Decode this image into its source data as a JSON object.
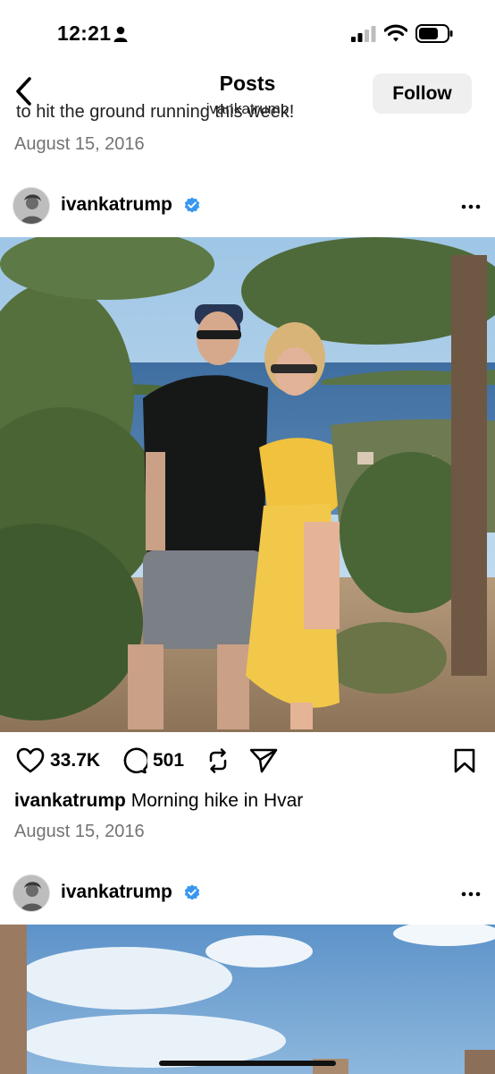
{
  "status_bar": {
    "time": "12:21"
  },
  "header": {
    "title": "Posts",
    "subtitle": "ivankatrump",
    "follow_label": "Follow"
  },
  "previous_post": {
    "caption_fragment": "to hit the ground running this week!",
    "date": "August 15, 2016"
  },
  "post": {
    "username": "ivankatrump",
    "likes": "33.7K",
    "comments": "501",
    "caption_user": "ivankatrump",
    "caption_text": " Morning hike in Hvar",
    "date": "August 15, 2016"
  },
  "next_post": {
    "username": "ivankatrump"
  },
  "icons": {
    "back": "chevron-left-icon",
    "verified": "verified-badge-icon",
    "more": "more-dots-icon",
    "like": "heart-icon",
    "comment": "comment-bubble-icon",
    "repost": "repost-icon",
    "share": "paper-plane-icon",
    "save": "bookmark-icon"
  },
  "colors": {
    "verified": "#3897f0",
    "secondary_text": "#737373",
    "follow_bg": "#efefef"
  }
}
